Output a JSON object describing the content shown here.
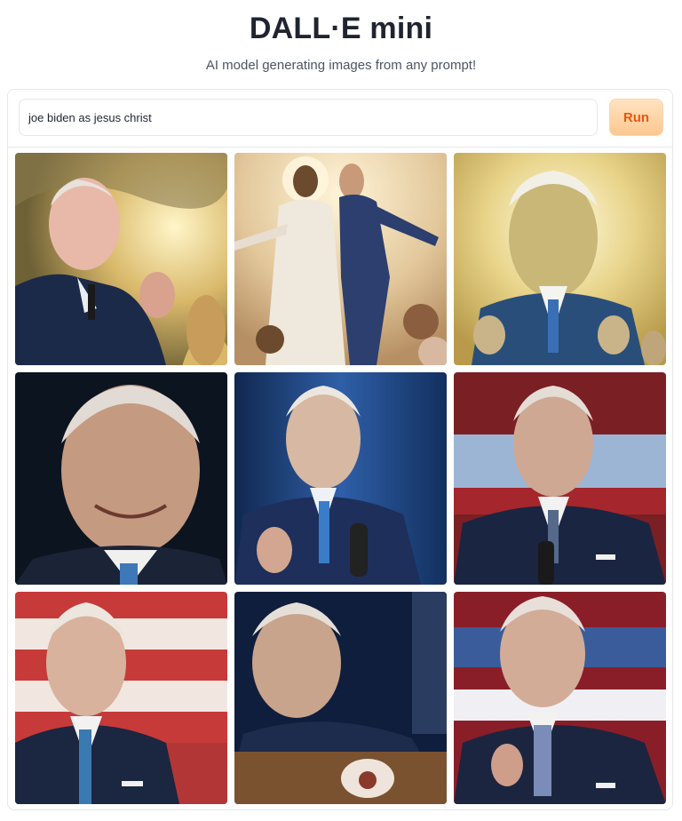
{
  "header": {
    "title": "DALL·E mini",
    "subtitle": "AI model generating images from any prompt!"
  },
  "prompt": {
    "value": "joe biden as jesus christ",
    "run_label": "Run"
  },
  "colors": {
    "accent": "#ea580c",
    "button_bg": "#fdd3a6",
    "border": "#e5e7eb"
  },
  "gallery": {
    "image_count": 9,
    "images": [
      {
        "scene": "golden-clouds"
      },
      {
        "scene": "painting-two-figures"
      },
      {
        "scene": "golden-halo"
      },
      {
        "scene": "dark-portrait"
      },
      {
        "scene": "blue-stage"
      },
      {
        "scene": "flag-backdrop"
      },
      {
        "scene": "flag-backdrop"
      },
      {
        "scene": "podium-dark"
      },
      {
        "scene": "flag-backdrop"
      }
    ]
  }
}
